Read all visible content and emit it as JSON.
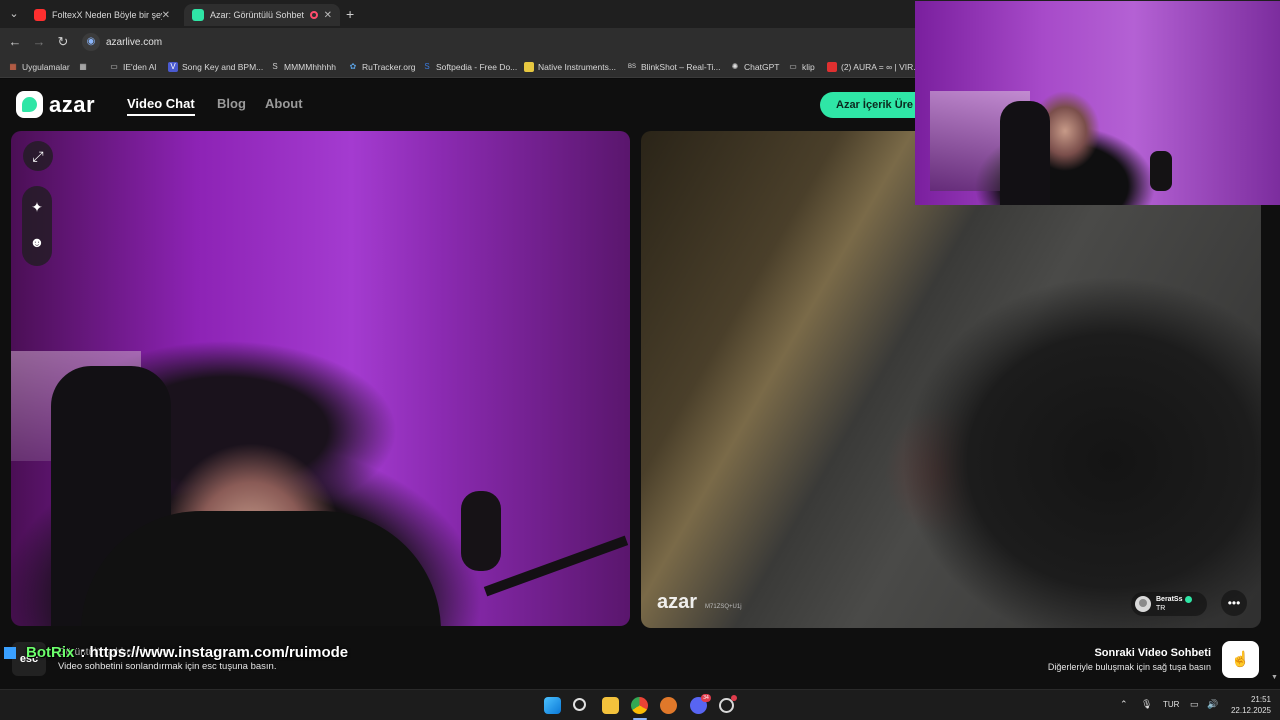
{
  "browser": {
    "tabs": [
      {
        "title": "FoltexX Neden Böyle bir şey va",
        "favicon": "youtube-icon"
      },
      {
        "title": "Azar: Görüntülü Sohbet & V",
        "favicon": "azar-icon",
        "active": true
      }
    ],
    "new_tab": "+",
    "url": "azarlive.com",
    "bookmarks": [
      "Uygulamalar",
      "IE'den Al",
      "Song Key and BPM...",
      "MMMMhhhhh",
      "RuTracker.org",
      "Softpedia - Free Do...",
      "Native Instruments...",
      "BlinkShot – Real-Ti...",
      "ChatGPT",
      "klip",
      "(2) AURA = ∞ | VIR..."
    ]
  },
  "azar": {
    "logo_text": "azar",
    "nav": {
      "video_chat": "Video Chat",
      "blog": "Blog",
      "about": "About"
    },
    "cta": "Azar İçerik Üre",
    "watermark": "azar",
    "watermark_id": "M71ZSQ+U1j",
    "peer": {
      "name": "BeratSs",
      "country": "TR"
    },
    "footer": {
      "esc_key": "esc",
      "stop_title": "Görüntülü sohbeti durdur",
      "stop_hint": "Video sohbetini sonlandırmak için esc tuşuna basın.",
      "next_title": "Sonraki Video Sohbeti",
      "next_hint": "Diğerleriyle buluşmak için sağ tuşa basın"
    }
  },
  "stream_overlay": {
    "name": "BotRix",
    "message": ": https://www.instagram.com/ruimode"
  },
  "taskbar": {
    "language": "TUR",
    "time": "21:51",
    "date": "22.12.2025",
    "discord_badge": "34"
  },
  "colors": {
    "accent": "#2fe6a6",
    "purple_light": "#a43bd0"
  }
}
